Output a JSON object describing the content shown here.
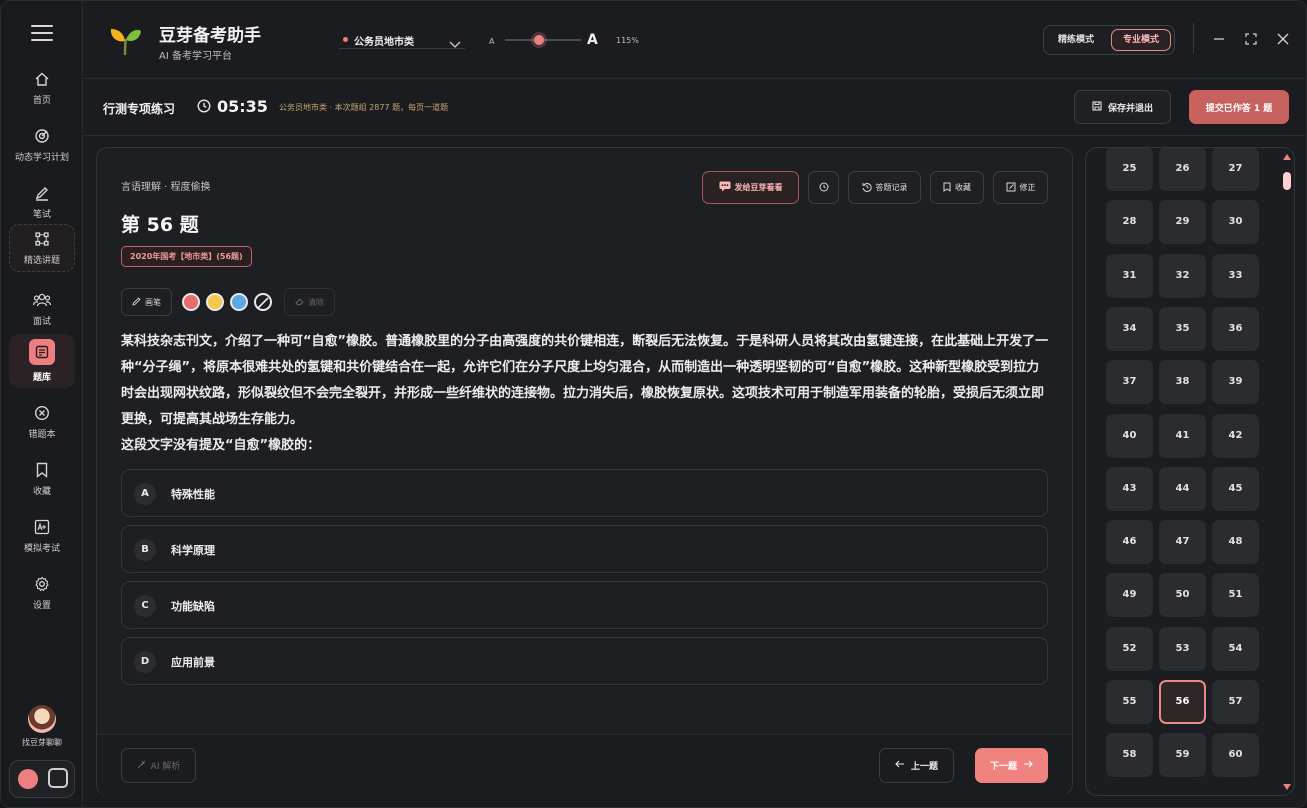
{
  "sidebar": {
    "items": [
      {
        "label": "首页",
        "icon": "home-icon"
      },
      {
        "label": "动态学习计划",
        "icon": "target-icon"
      },
      {
        "label": "笔试",
        "icon": "pen-icon"
      },
      {
        "label": "精选讲题",
        "icon": "nodes-icon"
      },
      {
        "label": "面试",
        "icon": "users-icon"
      },
      {
        "label": "题库",
        "icon": "book-icon"
      },
      {
        "label": "错题本",
        "icon": "error-circle-icon"
      },
      {
        "label": "收藏",
        "icon": "bookmark-icon"
      },
      {
        "label": "模拟考试",
        "icon": "exam-icon"
      },
      {
        "label": "设置",
        "icon": "gear-icon"
      }
    ],
    "chat_label": "找豆芽聊聊"
  },
  "header": {
    "brand": "豆芽备考助手",
    "subtitle": "AI 备考学习平台",
    "category": "公务员地市类",
    "font_small": "A",
    "font_large": "A",
    "zoom": "115%",
    "font_scale_fraction": 0.45,
    "mode_a": "精练模式",
    "mode_b": "专业模式"
  },
  "subbar": {
    "title": "行测专项练习",
    "timer": "05:35",
    "info": "公务员地市类 · 本次题组 2877 题，每页一道题",
    "save_label": "保存并退出",
    "submit_label": "提交已作答 1 题"
  },
  "question": {
    "breadcrumb": "言语理解 · 程度偷换",
    "title": "第 56 题",
    "tag": "2020年国考【地市类】(56题)",
    "actions": {
      "send": "发给豆芽看看",
      "record": "答题记录",
      "fav": "收藏",
      "fix": "修正"
    },
    "tools": {
      "pen": "画笔",
      "clear": "清除"
    },
    "text": "某科技杂志刊文，介绍了一种可“自愈”橡胶。普通橡胶里的分子由高强度的共价键相连，断裂后无法恢复。于是科研人员将其改由氢键连接，在此基础上开发了一种“分子绳”，将原本很难共处的氢键和共价键结合在一起，允许它们在分子尺度上均匀混合，从而制造出一种透明坚韧的可“自愈”橡胶。这种新型橡胶受到拉力时会出现网状纹路，形似裂纹但不会完全裂开，并形成一些纤维状的连接物。拉力消失后，橡胶恢复原状。这项技术可用于制造军用装备的轮胎，受损后无须立即更换，可提高其战场生存能力。",
    "prompt": "这段文字没有提及“自愈”橡胶的：",
    "options": [
      {
        "letter": "A",
        "text": "特殊性能"
      },
      {
        "letter": "B",
        "text": "科学原理"
      },
      {
        "letter": "C",
        "text": "功能缺陷"
      },
      {
        "letter": "D",
        "text": "应用前景"
      }
    ],
    "footer": {
      "ai": "AI 解析",
      "prev": "上一题",
      "next": "下一题"
    }
  },
  "grid": {
    "numbers": [
      "25",
      "26",
      "27",
      "28",
      "29",
      "30",
      "31",
      "32",
      "33",
      "34",
      "35",
      "36",
      "37",
      "38",
      "39",
      "40",
      "41",
      "42",
      "43",
      "44",
      "45",
      "46",
      "47",
      "48",
      "49",
      "50",
      "51",
      "52",
      "53",
      "54",
      "55",
      "56",
      "57",
      "58",
      "59",
      "60"
    ],
    "current": "56"
  },
  "colors": {
    "accent": "#ee7f80",
    "pen_red": "#e86b6e",
    "pen_yellow": "#f2c94c",
    "pen_blue": "#5aa8e6"
  }
}
